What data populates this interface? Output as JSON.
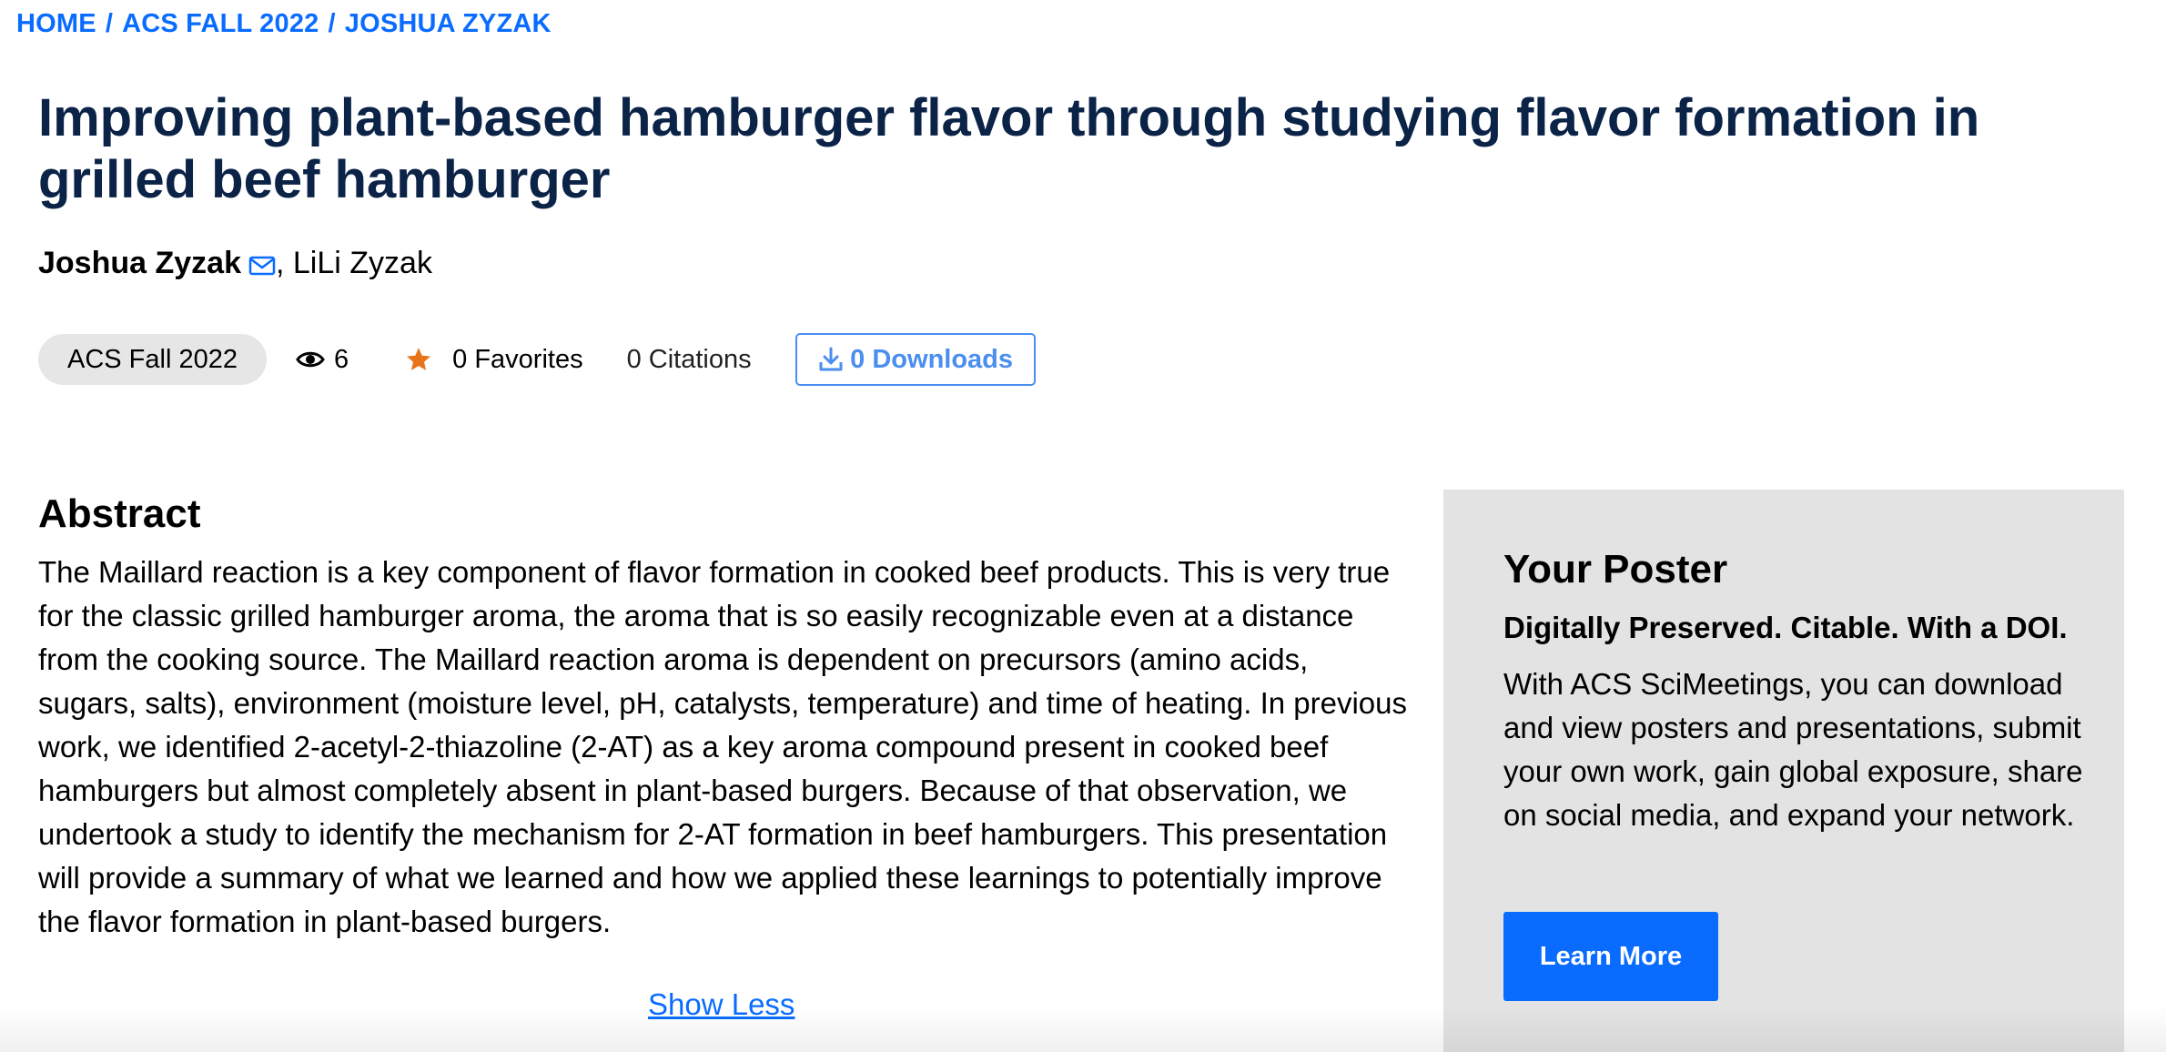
{
  "breadcrumb": {
    "items": [
      "HOME",
      "ACS FALL 2022",
      "JOSHUA ZYZAK"
    ],
    "separator": "/"
  },
  "title": "Improving plant-based hamburger flavor through studying flavor formation in grilled beef hamburger",
  "authors": {
    "primary": "Joshua Zyzak",
    "separator": ",",
    "secondary": "LiLi Zyzak"
  },
  "meta": {
    "event": "ACS Fall 2022",
    "views": "6",
    "favorites": "0 Favorites",
    "citations": "0 Citations",
    "downloads": "0 Downloads"
  },
  "abstract": {
    "heading": "Abstract",
    "text": "The Maillard reaction is a key component of flavor formation in cooked beef products. This is very true for the classic grilled hamburger aroma, the aroma that is so easily recognizable even at a distance from the cooking source. The Maillard reaction aroma is dependent on precursors (amino acids, sugars, salts), environment (moisture level, pH, catalysts, temperature) and time of heating. In previous work, we identified 2-acetyl-2-thiazoline (2-AT) as a key aroma compound present in cooked beef hamburgers but almost completely absent in plant-based burgers. Because of that observation, we undertook a study to identify the mechanism for 2-AT formation in beef hamburgers. This presentation will provide a summary of what we learned and how we applied these learnings to potentially improve the flavor formation in plant-based burgers.",
    "toggle_label": "Show Less"
  },
  "poster_card": {
    "title": "Your Poster",
    "subtitle": "Digitally Preserved. Citable. With a DOI.",
    "body": "With ACS SciMeetings, you can download and view posters and presentations, submit your own work, gain global exposure, share on social media, and expand your network.",
    "button_label": "Learn More"
  },
  "icons": {
    "author_contact": "mail-icon",
    "views": "eye-icon",
    "favorites": "star-icon",
    "downloads": "download-icon"
  },
  "colors": {
    "accent": "#0a6cff",
    "title": "#0b2347",
    "star": "#e8731a",
    "pill_bg": "#e6e6e6",
    "card_bg": "#e3e3e3"
  }
}
